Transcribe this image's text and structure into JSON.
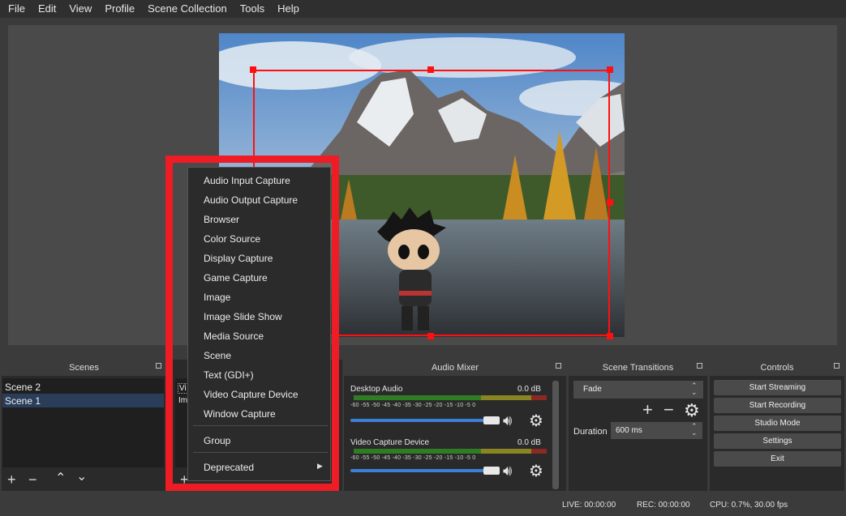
{
  "menubar": [
    "File",
    "Edit",
    "View",
    "Profile",
    "Scene Collection",
    "Tools",
    "Help"
  ],
  "scenes": {
    "title": "Scenes",
    "items": [
      "Scene 2",
      "Scene 1"
    ],
    "selected_index": 1
  },
  "sources": {
    "visible_items": [
      "Vi",
      "Im"
    ]
  },
  "context_menu": {
    "items": [
      "Audio Input Capture",
      "Audio Output Capture",
      "Browser",
      "Color Source",
      "Display Capture",
      "Game Capture",
      "Image",
      "Image Slide Show",
      "Media Source",
      "Scene",
      "Text (GDI+)",
      "Video Capture Device",
      "Window Capture"
    ],
    "group": "Group",
    "deprecated": "Deprecated"
  },
  "audio_mixer": {
    "title": "Audio Mixer",
    "scale": "-60 -55 -50 -45 -40 -35 -30 -25 -20 -15 -10 -5 0",
    "channels": [
      {
        "name": "Desktop Audio",
        "level": "0.0 dB",
        "volume": 0.97
      },
      {
        "name": "Video Capture Device",
        "level": "0.0 dB",
        "volume": 0.97
      }
    ]
  },
  "transitions": {
    "title": "Scene Transitions",
    "selected": "Fade",
    "duration_label": "Duration",
    "duration_value": "600 ms"
  },
  "controls": {
    "title": "Controls",
    "buttons": [
      "Start Streaming",
      "Start Recording",
      "Studio Mode",
      "Settings",
      "Exit"
    ]
  },
  "status": {
    "live": "LIVE: 00:00:00",
    "rec": "REC: 00:00:00",
    "cpu": "CPU: 0.7%, 30.00 fps"
  },
  "colors": {
    "accent_red": "#ee1c25",
    "selection_red": "#ff1010",
    "slider_blue": "#3d7fd6"
  }
}
